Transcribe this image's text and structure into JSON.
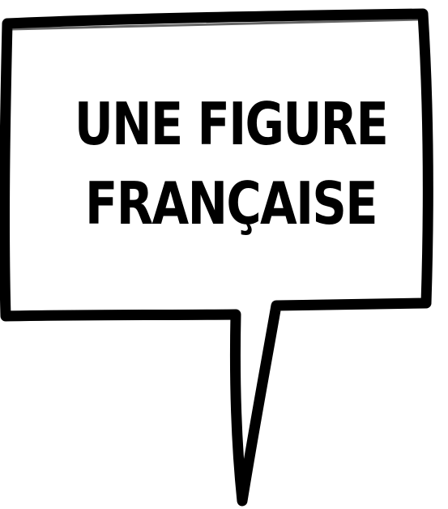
{
  "speech_bubble": {
    "line_1": "UNE FIGURE",
    "line_2": "FRANÇAISE"
  },
  "colors": {
    "stroke": "#000000",
    "fill": "#ffffff",
    "text": "#000000"
  }
}
